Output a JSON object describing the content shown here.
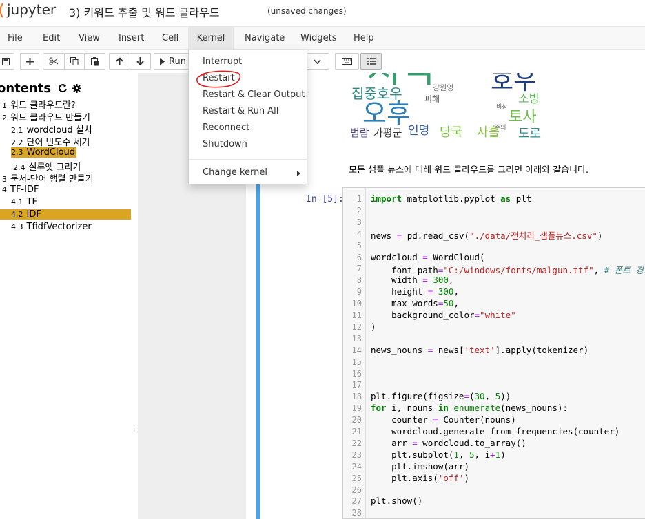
{
  "header": {
    "logo_text": "jupyter",
    "notebook_name": "3) 키워드 추출 및 워드 클라우드",
    "save_status": "(unsaved changes)"
  },
  "menubar": {
    "items": [
      "File",
      "Edit",
      "View",
      "Insert",
      "Cell",
      "Kernel",
      "Navigate",
      "Widgets",
      "Help"
    ],
    "active": "Kernel"
  },
  "toolbar": {
    "run_label": "Run",
    "icons": [
      "save-icon",
      "plus-icon",
      "scissors-icon",
      "copy-icon",
      "paste-icon",
      "arrow-up-icon",
      "arrow-down-icon",
      "run-icon",
      "keyboard-icon",
      "list-icon"
    ]
  },
  "kernel_menu": {
    "items": [
      "Interrupt",
      "Restart",
      "Restart & Clear Output",
      "Restart & Run All",
      "Reconnect",
      "Shutdown"
    ],
    "submenu": "Change kernel",
    "circled_item": "Restart",
    "annotation_color": "#e02020"
  },
  "toc": {
    "title": "ontents",
    "items": [
      {
        "num": "1",
        "label": "워드 클라우드란?",
        "highlight": false
      },
      {
        "num": "2",
        "label": "워드 클라우드 만들기",
        "highlight": false
      },
      {
        "num": "2.1",
        "label": "wordcloud 설치",
        "highlight": false
      },
      {
        "num": "2.2",
        "label": "단어 빈도수 세기",
        "highlight": false
      },
      {
        "num": "2.3",
        "label": "WordCloud",
        "highlight": true
      },
      {
        "num": "2.4",
        "label": "실루엣 그리기",
        "highlight": false
      },
      {
        "num": "3",
        "label": "문서-단어 행렬 만들기",
        "highlight": false
      },
      {
        "num": "4",
        "label": "TF-IDF",
        "highlight": false
      },
      {
        "num": "4.1",
        "label": "TF",
        "highlight": false
      },
      {
        "num": "4.2",
        "label": "IDF",
        "highlight": true
      },
      {
        "num": "4.3",
        "label": "TfidfVectorizer",
        "highlight": false
      }
    ],
    "highlight_color": "#daa520",
    "resize_glyph": "⁞"
  },
  "notebook": {
    "markdown_text": "모든 샘플 뉴스에 대해 워드 클라우드를 그리면 아래와 같습니다.",
    "prompt": "In [5]:",
    "line_numbers": [
      "1",
      "2",
      "3",
      "4",
      "5",
      "6",
      "7",
      "8",
      "9",
      "10",
      "11",
      "12",
      "13",
      "14",
      "15",
      "16",
      "17",
      "18",
      "19",
      "20",
      "21",
      "22",
      "23",
      "24",
      "25",
      "26",
      "27",
      "28"
    ],
    "code_lines": [
      "import matplotlib.pyplot as plt",
      "",
      "",
      "news = pd.read_csv(\"./data/전처리_샘플뉴스.csv\")",
      "",
      "wordcloud = WordCloud(",
      "    font_path=\"C:/windows/fonts/malgun.ttf\", # 폰트 경로",
      "    width = 300,",
      "    height = 300,",
      "    max_words=50,",
      "    background_color=\"white\"",
      ")",
      "",
      "news_nouns = news['text'].apply(tokenizer)",
      "",
      "",
      "",
      "plt.figure(figsize=(30, 5))",
      "for i, nouns in enumerate(news_nouns):",
      "    counter = Counter(nouns)",
      "    wordcloud.generate_from_frequencies(counter)",
      "    arr = wordcloud.to_array()",
      "    plt.subplot(1, 5, i+1)",
      "    plt.imshow(arr)",
      "    plt.axis('off')",
      "",
      "plt.show()",
      ""
    ],
    "wordcloud_words": [
      "지역",
      "오후",
      "집중호우",
      "토사",
      "소방",
      "범람",
      "가평군",
      "인명",
      "당국",
      "사흘",
      "도로",
      "강원영",
      "피해",
      "호우",
      "비상",
      "주의"
    ],
    "accent_color": "#42a5f5"
  }
}
